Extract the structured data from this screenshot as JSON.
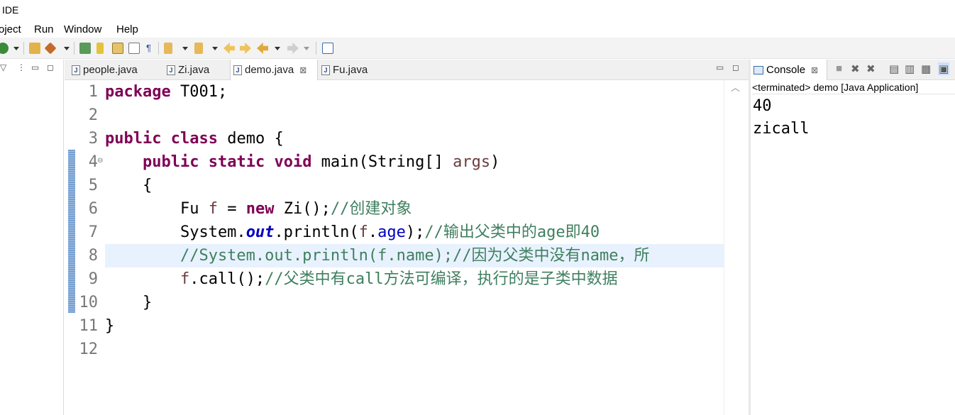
{
  "window": {
    "title": "IDE"
  },
  "menu": [
    "oject",
    "Run",
    "Window",
    "Help"
  ],
  "toolbar": {
    "icons": [
      "refresh-icon",
      "open-folder-icon",
      "rocket-icon",
      "flag-icon",
      "pencil-icon",
      "copy-icon",
      "file-icon",
      "pilcrow-icon",
      "next-annotation-icon",
      "prev-annotation-icon",
      "back-history-icon",
      "forward-history-icon",
      "back-icon",
      "forward-icon",
      "new-window-icon"
    ],
    "pilcrow": "¶"
  },
  "editor": {
    "tabs": [
      {
        "label": "people.java",
        "active": false
      },
      {
        "label": "Zi.java",
        "active": false
      },
      {
        "label": "demo.java",
        "active": true,
        "close": "⊠"
      },
      {
        "label": "Fu.java",
        "active": false
      }
    ],
    "line_numbers": [
      "1",
      "2",
      "3",
      "4",
      "5",
      "6",
      "7",
      "8",
      "9",
      "10",
      "11",
      "12"
    ],
    "current_line": 8,
    "lines": [
      [
        {
          "t": "package",
          "c": "kw"
        },
        {
          "t": " T001;",
          "c": ""
        }
      ],
      [],
      [
        {
          "t": "public",
          "c": "kw"
        },
        {
          "t": " ",
          "c": ""
        },
        {
          "t": "class",
          "c": "kw"
        },
        {
          "t": " demo {",
          "c": ""
        }
      ],
      [
        {
          "t": "    ",
          "c": ""
        },
        {
          "t": "public",
          "c": "kw"
        },
        {
          "t": " ",
          "c": ""
        },
        {
          "t": "static",
          "c": "kw"
        },
        {
          "t": " ",
          "c": ""
        },
        {
          "t": "void",
          "c": "kw"
        },
        {
          "t": " main(String[] ",
          "c": ""
        },
        {
          "t": "args",
          "c": "var"
        },
        {
          "t": ")",
          "c": ""
        }
      ],
      [
        {
          "t": "    {",
          "c": ""
        }
      ],
      [
        {
          "t": "        Fu ",
          "c": ""
        },
        {
          "t": "f",
          "c": "var"
        },
        {
          "t": " = ",
          "c": ""
        },
        {
          "t": "new",
          "c": "kw"
        },
        {
          "t": " Zi();",
          "c": ""
        },
        {
          "t": "//创建对象",
          "c": "cmt"
        }
      ],
      [
        {
          "t": "        System.",
          "c": ""
        },
        {
          "t": "out",
          "c": "static"
        },
        {
          "t": ".println(",
          "c": ""
        },
        {
          "t": "f",
          "c": "var"
        },
        {
          "t": ".",
          "c": ""
        },
        {
          "t": "age",
          "c": "field"
        },
        {
          "t": ");",
          "c": ""
        },
        {
          "t": "//输出父类中的age即40",
          "c": "cmt"
        }
      ],
      [
        {
          "t": "        //System.out.println(f.name);//因为父类中没有name，所",
          "c": "cmt"
        }
      ],
      [
        {
          "t": "        ",
          "c": ""
        },
        {
          "t": "f",
          "c": "var"
        },
        {
          "t": ".call();",
          "c": ""
        },
        {
          "t": "//父类中有call方法可编译，执行的是子类中数据",
          "c": "cmt"
        }
      ],
      [
        {
          "t": "    }",
          "c": ""
        }
      ],
      [
        {
          "t": "}",
          "c": ""
        }
      ],
      []
    ]
  },
  "console": {
    "tab_label": "Console",
    "close": "⊠",
    "status": "<terminated> demo [Java Application]",
    "output": [
      "40",
      "zicall"
    ]
  }
}
